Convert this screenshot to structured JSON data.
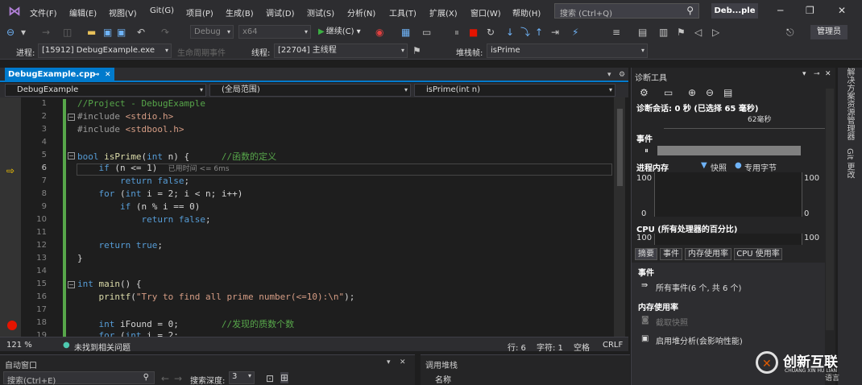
{
  "menubar": {
    "items": [
      "文件(F)",
      "编辑(E)",
      "视图(V)",
      "Git(G)",
      "项目(P)",
      "生成(B)",
      "调试(D)",
      "测试(S)",
      "分析(N)",
      "工具(T)",
      "扩展(X)",
      "窗口(W)",
      "帮助(H)"
    ],
    "search_placeholder": "搜索 (Ctrl+Q)",
    "solution_name": "Deb...ple"
  },
  "toolbar": {
    "config": "Debug",
    "platform": "x64",
    "continue_label": "继续(C) ▾",
    "signin_label": "管理员"
  },
  "debugbar": {
    "process_label": "进程:",
    "process_value": "[15912] DebugExample.exe",
    "lifecycle_label": "生命周期事件",
    "thread_label": "线程:",
    "thread_value": "[22704] 主线程",
    "stackframe_label": "堆栈帧:",
    "stackframe_value": "isPrime"
  },
  "editor": {
    "tab_name": "DebugExample.cpp",
    "nav_project": "DebugExample",
    "nav_scope": "(全局范围)",
    "nav_function": "isPrime(int n)",
    "line_numbers": [
      "1",
      "2",
      "3",
      "4",
      "5",
      "6",
      "7",
      "8",
      "9",
      "10",
      "11",
      "12",
      "13",
      "14",
      "15",
      "16",
      "17",
      "18",
      "19"
    ],
    "perf_tip": "已用时间 <= 6ms",
    "status_zoom": "121 %",
    "status_issues": "未找到相关问题",
    "status_line": "行: 6",
    "status_char": "字符: 1",
    "status_space": "空格",
    "status_eol": "CRLF"
  },
  "bottom": {
    "autos_title": "自动窗口",
    "autos_search": "搜索(Ctrl+E)",
    "search_depth_label": "搜索深度:",
    "search_depth_value": "3",
    "callstack_title": "调用堆栈",
    "callstack_col_name": "名称"
  },
  "diagnostics": {
    "title": "诊断工具",
    "session": "诊断会话: 0 秒 (已选择 65 毫秒)",
    "time_marker": "62毫秒",
    "events_header": "事件",
    "memory_header": "进程内存",
    "memory_legend_snapshot": "快照",
    "memory_legend_private": "专用字节",
    "mem_max_left": "100",
    "mem_min_left": "0",
    "mem_max_right": "100",
    "mem_min_right": "0",
    "cpu_header": "CPU (所有处理器的百分比)",
    "cpu_max_left": "100",
    "cpu_max_right": "100",
    "tabs": [
      "摘要",
      "事件",
      "内存使用率",
      "CPU 使用率"
    ],
    "events_section": "事件",
    "all_events": "所有事件(6 个, 共 6 个)",
    "memory_section": "内存使用率",
    "take_snapshot": "截取快照",
    "heap_analysis": "启用堆分析(会影响性能)"
  },
  "side_tabs": [
    "解决方案资源管理器",
    "Git 更改"
  ],
  "watermark": {
    "brand": "创新互联",
    "brand_sub": "CHUANG XIN HU LIAN",
    "lang": "语言"
  }
}
